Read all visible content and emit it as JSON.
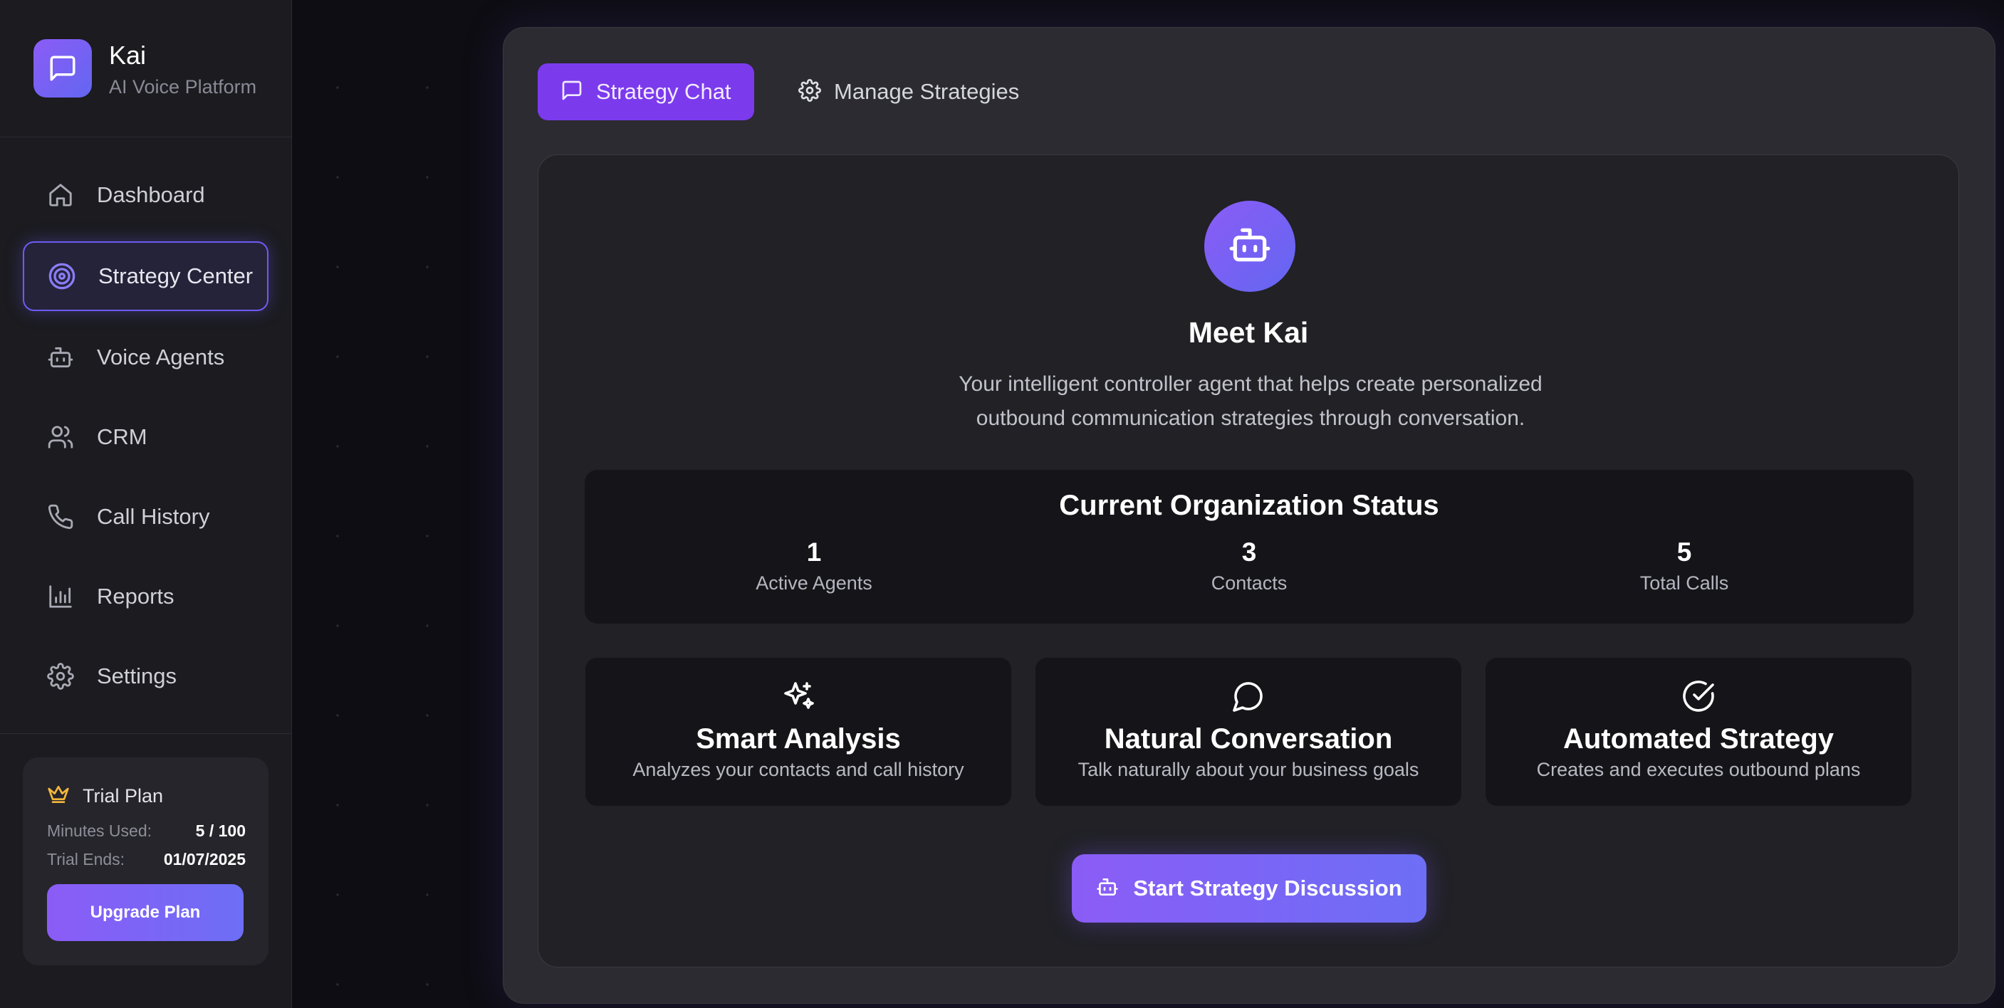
{
  "app": {
    "name": "Kai",
    "subtitle": "AI Voice Platform",
    "logo_icon": "chat-bubble-icon"
  },
  "sidebar": {
    "items": [
      {
        "label": "Dashboard",
        "icon": "home-icon",
        "active": false
      },
      {
        "label": "Strategy Center",
        "icon": "target-icon",
        "active": true
      },
      {
        "label": "Voice Agents",
        "icon": "bot-icon",
        "active": false
      },
      {
        "label": "CRM",
        "icon": "users-icon",
        "active": false
      },
      {
        "label": "Call History",
        "icon": "phone-icon",
        "active": false
      },
      {
        "label": "Reports",
        "icon": "bar-chart-icon",
        "active": false
      },
      {
        "label": "Settings",
        "icon": "gear-icon",
        "active": false
      }
    ]
  },
  "plan": {
    "title": "Trial Plan",
    "icon": "crown-icon",
    "minutes_label": "Minutes Used:",
    "minutes_value": "5 / 100",
    "ends_label": "Trial Ends:",
    "ends_value": "01/07/2025",
    "upgrade_label": "Upgrade Plan"
  },
  "tabs": [
    {
      "label": "Strategy Chat",
      "icon": "chat-icon",
      "active": true
    },
    {
      "label": "Manage Strategies",
      "icon": "gear-icon",
      "active": false
    }
  ],
  "intro": {
    "title": "Meet Kai",
    "description_line1": "Your intelligent controller agent that helps create personalized",
    "description_line2": "outbound communication strategies through conversation."
  },
  "status": {
    "title": "Current Organization Status",
    "stats": [
      {
        "value": "1",
        "label": "Active Agents"
      },
      {
        "value": "3",
        "label": "Contacts"
      },
      {
        "value": "5",
        "label": "Total Calls"
      }
    ]
  },
  "features": [
    {
      "title": "Smart Analysis",
      "description": "Analyzes your contacts and call history",
      "icon": "sparkles-icon"
    },
    {
      "title": "Natural Conversation",
      "description": "Talk naturally about your business goals",
      "icon": "message-circle-icon"
    },
    {
      "title": "Automated Strategy",
      "description": "Creates and executes outbound plans",
      "icon": "check-circle-icon"
    }
  ],
  "cta": {
    "label": "Start Strategy Discussion",
    "icon": "bot-icon"
  },
  "colors": {
    "accent": "#7c3aed",
    "accent_gradient_end": "#6366f1",
    "crown": "#f5b83d"
  }
}
